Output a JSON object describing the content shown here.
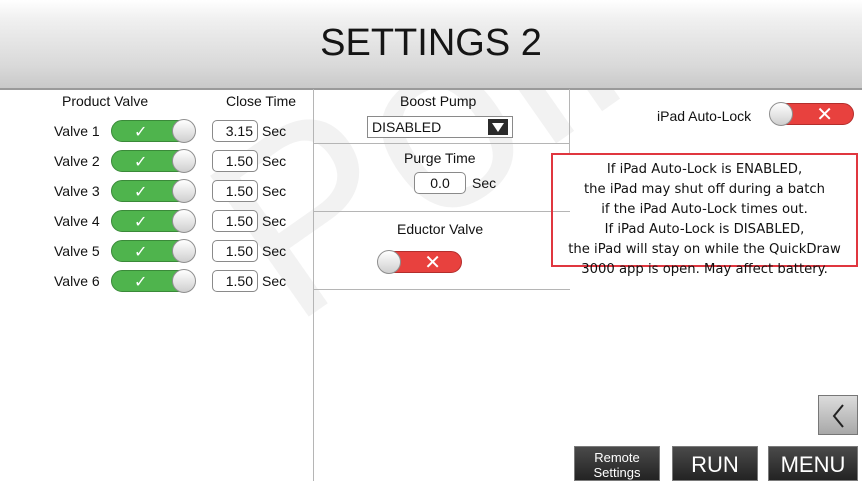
{
  "header": {
    "title": "SETTINGS 2"
  },
  "valves": {
    "product_valve_header": "Product Valve",
    "close_time_header": "Close Time",
    "unit": "Sec",
    "items": [
      {
        "label": "Valve 1",
        "close_time": "3.15",
        "enabled": true
      },
      {
        "label": "Valve 2",
        "close_time": "1.50",
        "enabled": true
      },
      {
        "label": "Valve 3",
        "close_time": "1.50",
        "enabled": true
      },
      {
        "label": "Valve 4",
        "close_time": "1.50",
        "enabled": true
      },
      {
        "label": "Valve 5",
        "close_time": "1.50",
        "enabled": true
      },
      {
        "label": "Valve 6",
        "close_time": "1.50",
        "enabled": true
      }
    ]
  },
  "boost_pump": {
    "label": "Boost Pump",
    "selected": "DISABLED"
  },
  "purge_time": {
    "label": "Purge Time",
    "value": "0.0",
    "unit": "Sec"
  },
  "eductor_valve": {
    "label": "Eductor Valve",
    "enabled": false
  },
  "ipad_auto_lock": {
    "label": "iPad Auto-Lock",
    "enabled": false,
    "notice_lines": [
      "If iPad Auto-Lock is ENABLED,",
      "the iPad may shut off during a batch",
      "if the iPad Auto-Lock times out.",
      "If iPad Auto-Lock is DISABLED,",
      "the iPad will stay on while the QuickDraw",
      "3000 app is open. May affect battery."
    ]
  },
  "buttons": {
    "back_icon": "chevron-left-icon",
    "remote_settings_line1": "Remote",
    "remote_settings_line2": "Settings",
    "run": "RUN",
    "menu": "MENU"
  },
  "watermark": "Point A9",
  "colors": {
    "toggle_on": "#4fb44d",
    "toggle_off": "#e8413e",
    "notice_border": "#e0363f"
  }
}
